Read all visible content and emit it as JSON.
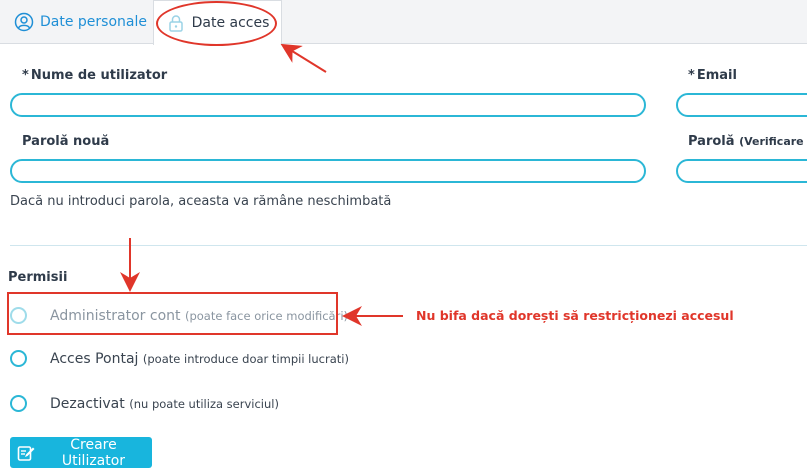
{
  "tabs": {
    "personal": "Date personale",
    "access": "Date acces"
  },
  "form": {
    "username_label": "Nume de utilizator",
    "email_label": "Email",
    "new_password_label": "Parolă nouă",
    "verify_password_label": "Parolă",
    "verify_password_note": "(Verificare",
    "required_marker": "*",
    "password_hint": "Dacă nu introduci parola, aceasta va rămâne neschimbată",
    "username_value": "",
    "email_value": "",
    "new_password_value": "",
    "verify_password_value": ""
  },
  "permissions": {
    "title": "Permisii",
    "options": [
      {
        "label": "Administrator cont",
        "note": "(poate face orice modificări)"
      },
      {
        "label": "Acces Pontaj",
        "note": "(poate introduce doar timpii lucrati)"
      },
      {
        "label": "Dezactivat",
        "note": "(nu poate utiliza serviciul)"
      }
    ]
  },
  "annotation": {
    "callout": "Nu bifa dacă dorești să restricționezi accesul"
  },
  "actions": {
    "create_label": "Creare Utilizator"
  },
  "colors": {
    "accent": "#2bb7d6",
    "button": "#18b5dd",
    "annotation": "#e0362a",
    "tab_active_text": "#1f8fd6"
  }
}
